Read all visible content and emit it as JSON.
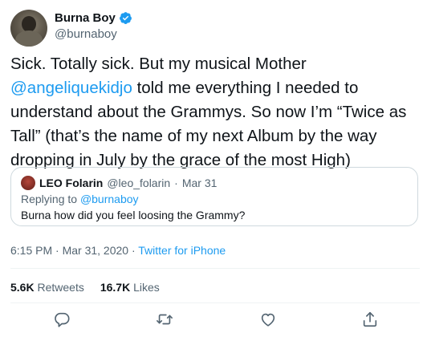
{
  "author": {
    "display_name": "Burna Boy",
    "handle": "@burnaboy",
    "verified": true
  },
  "tweet": {
    "text_before": "Sick. Totally sick. But my musical Mother ",
    "mention": "@angeliquekidjo",
    "text_after": " told me everything I needed to understand about the Grammys. So now I’m “Twice as Tall” (that’s the name of my next Album by the way dropping in July by the grace of the most High)"
  },
  "quoted_tweet": {
    "display_name": "LEO Folarin",
    "handle": "@leo_folarin",
    "separator": "·",
    "date": "Mar 31",
    "replying_prefix": "Replying to ",
    "replying_to": "@burnaboy",
    "text": "Burna how did you feel loosing the Grammy?"
  },
  "meta": {
    "timestamp": "6:15 PM · Mar 31, 2020 · ",
    "source": "Twitter for iPhone"
  },
  "stats": {
    "retweets_count": "5.6K",
    "retweets_label": "Retweets",
    "likes_count": "16.7K",
    "likes_label": "Likes"
  },
  "actions": [
    "reply-icon",
    "retweet-icon",
    "like-icon",
    "share-icon"
  ],
  "colors": {
    "accent": "#1d9bf0",
    "secondary_text": "#536471",
    "primary_text": "#0f1419",
    "border": "#cfd9de"
  }
}
